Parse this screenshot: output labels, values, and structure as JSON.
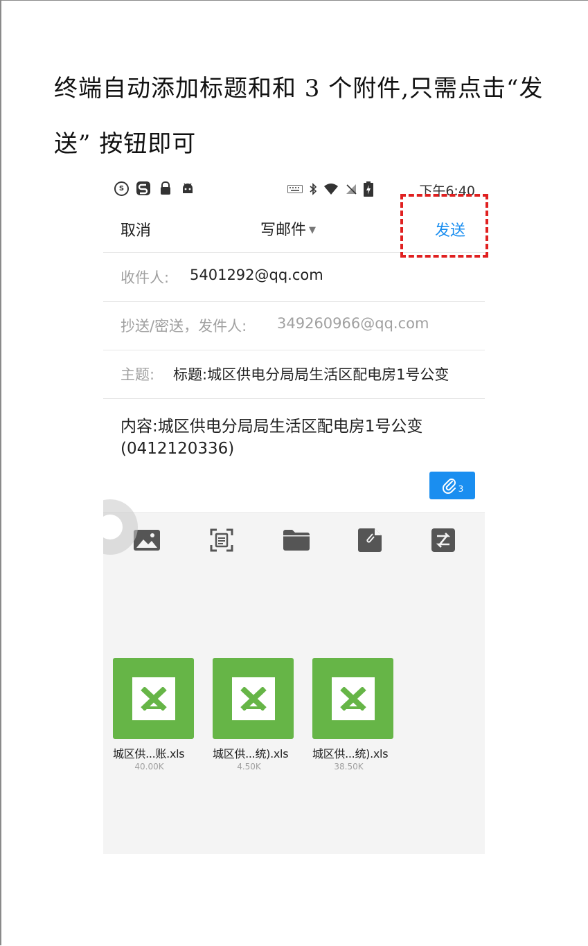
{
  "caption": {
    "line1": "终端自动添加标题和和 3 个附件,只需点击“发",
    "line2": "送” 按钮即可"
  },
  "status_bar": {
    "time": "下午6:40",
    "left_icons": [
      "sogou-round-icon",
      "s-app-icon",
      "lock-icon",
      "android-icon"
    ],
    "right_icons": [
      "keyboard-icon",
      "bluetooth-icon",
      "wifi-icon",
      "no-sim-icon",
      "battery-charging-icon"
    ]
  },
  "header": {
    "cancel": "取消",
    "title": "写邮件",
    "send": "发送"
  },
  "fields": {
    "to_label": "收件人:",
    "to_value": "5401292@qq.com",
    "cc_label": "抄送/密送，发件人:",
    "cc_value": "349260966@qq.com",
    "subject_label": "主题:",
    "subject_value": "标题:城区供电分局局生活区配电房1号公变"
  },
  "body": {
    "line1": "内容:城区供电分局局生活区配电房1号公变",
    "line2": "(0412120336)"
  },
  "attachment_badge": {
    "count": "3"
  },
  "toolbar": [
    "image-icon",
    "scan-icon",
    "folder-icon",
    "note-icon",
    "transfer-icon"
  ],
  "files": [
    {
      "name": "城区供...账.xls",
      "size": "40.00K"
    },
    {
      "name": "城区供...统).xls",
      "size": "4.50K"
    },
    {
      "name": "城区供...统).xls",
      "size": "38.50K"
    }
  ],
  "colors": {
    "accent": "#1a8ef0",
    "excel_green": "#66b547",
    "highlight_red": "#e02020"
  }
}
